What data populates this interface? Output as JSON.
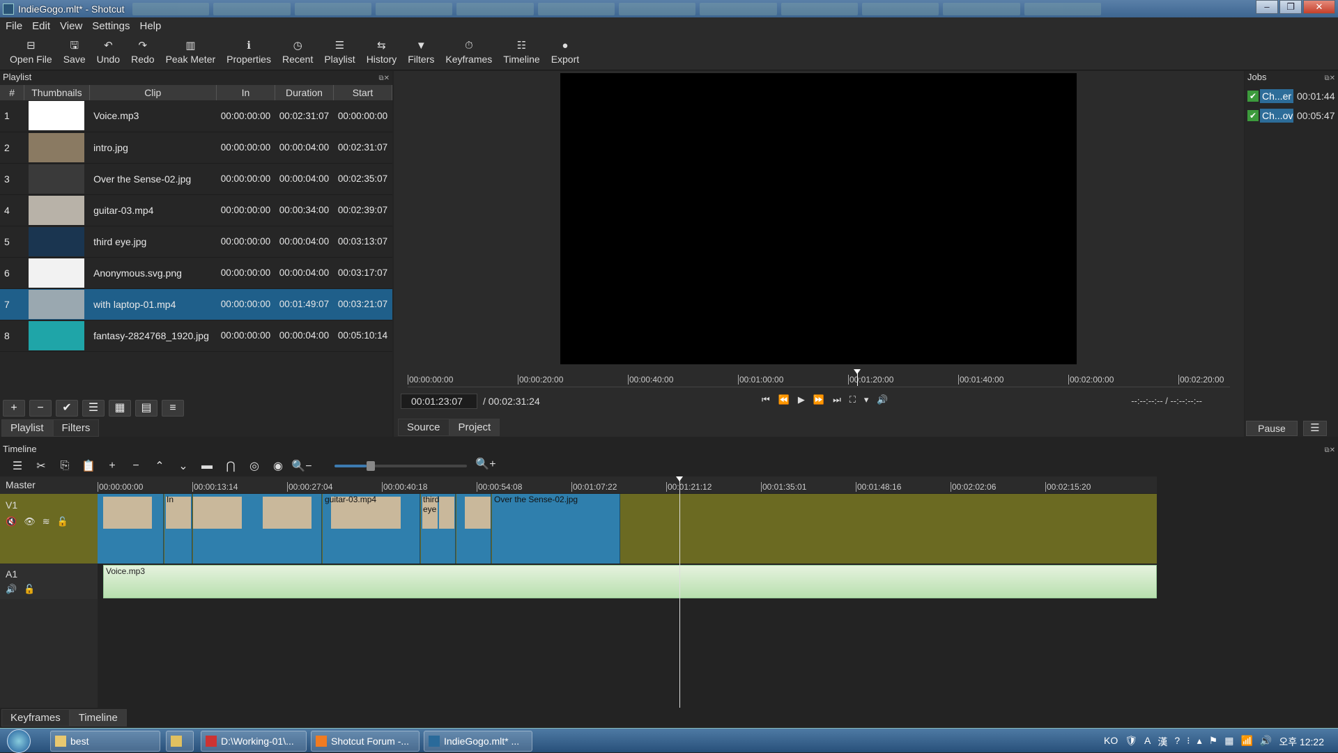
{
  "window": {
    "title": "IndieGogo.mlt* - Shotcut",
    "minimize": "–",
    "maximize": "❐",
    "close": "✕"
  },
  "menu": [
    "File",
    "Edit",
    "View",
    "Settings",
    "Help"
  ],
  "toolbar": [
    {
      "label": "Open File",
      "icon": "⊟"
    },
    {
      "label": "Save",
      "icon": "🖫"
    },
    {
      "label": "Undo",
      "icon": "↶"
    },
    {
      "label": "Redo",
      "icon": "↷"
    },
    {
      "label": "Peak Meter",
      "icon": "▥"
    },
    {
      "label": "Properties",
      "icon": "ℹ"
    },
    {
      "label": "Recent",
      "icon": "◷"
    },
    {
      "label": "Playlist",
      "icon": "☰"
    },
    {
      "label": "History",
      "icon": "⇆"
    },
    {
      "label": "Filters",
      "icon": "▼"
    },
    {
      "label": "Keyframes",
      "icon": "⏱"
    },
    {
      "label": "Timeline",
      "icon": "☷"
    },
    {
      "label": "Export",
      "icon": "●"
    }
  ],
  "playlist": {
    "title": "Playlist",
    "columns": [
      "#",
      "Thumbnails",
      "Clip",
      "In",
      "Duration",
      "Start"
    ],
    "rows": [
      {
        "n": "1",
        "clip": "Voice.mp3",
        "in": "00:00:00:00",
        "duration": "00:02:31:07",
        "start": "00:00:00:00",
        "thumb": "#ffffff"
      },
      {
        "n": "2",
        "clip": "intro.jpg",
        "in": "00:00:00:00",
        "duration": "00:00:04:00",
        "start": "00:02:31:07",
        "thumb": "#8a7a62"
      },
      {
        "n": "3",
        "clip": "Over the Sense-02.jpg",
        "in": "00:00:00:00",
        "duration": "00:00:04:00",
        "start": "00:02:35:07",
        "thumb": "#3a3a3a"
      },
      {
        "n": "4",
        "clip": "guitar-03.mp4",
        "in": "00:00:00:00",
        "duration": "00:00:34:00",
        "start": "00:02:39:07",
        "thumb": "#b8b2a8"
      },
      {
        "n": "5",
        "clip": "third eye.jpg",
        "in": "00:00:00:00",
        "duration": "00:00:04:00",
        "start": "00:03:13:07",
        "thumb": "#1a3550"
      },
      {
        "n": "6",
        "clip": "Anonymous.svg.png",
        "in": "00:00:00:00",
        "duration": "00:00:04:00",
        "start": "00:03:17:07",
        "thumb": "#f2f2f2"
      },
      {
        "n": "7",
        "clip": "with laptop-01.mp4",
        "in": "00:00:00:00",
        "duration": "00:01:49:07",
        "start": "00:03:21:07",
        "thumb": "#9aa8b0",
        "selected": true
      },
      {
        "n": "8",
        "clip": "fantasy-2824768_1920.jpg",
        "in": "00:00:00:00",
        "duration": "00:00:04:00",
        "start": "00:05:10:14",
        "thumb": "#1fa5a8"
      }
    ],
    "buttons": [
      "+",
      "−",
      "✔",
      "☰",
      "▦",
      "▤",
      "≡"
    ],
    "tabs": [
      "Playlist",
      "Filters"
    ]
  },
  "viewer": {
    "ruler": [
      "00:00:00:00",
      "00:00:20:00",
      "00:00:40:00",
      "00:01:00:00",
      "00:01:20:00",
      "00:01:40:00",
      "00:02:00:00",
      "00:02:20:00"
    ],
    "current_time": "00:01:23:07",
    "total_time": "/ 00:02:31:24",
    "transport": [
      "⏮",
      "⏪",
      "▶",
      "⏩",
      "⏭",
      "⛶",
      "▾",
      "🔊"
    ],
    "in_out": "--:--:--:-- / --:--:--:--",
    "tabs": [
      "Source",
      "Project"
    ]
  },
  "jobs": {
    "title": "Jobs",
    "items": [
      {
        "name": "Ch...er",
        "time": "00:01:44"
      },
      {
        "name": "Ch...ov",
        "time": "00:05:47"
      }
    ],
    "pause": "Pause",
    "menu": "☰"
  },
  "timeline": {
    "title": "Timeline",
    "toolbar": [
      "☰",
      "✂",
      "⎘",
      "📋",
      "+",
      "−",
      "⌃",
      "⌄",
      "▬",
      "⋂",
      "◎",
      "◉",
      "🔍−",
      "🔍+"
    ],
    "zoom": 0.24,
    "master": "Master",
    "ruler": [
      "00:00:00:00",
      "00:00:13:14",
      "00:00:27:04",
      "00:00:40:18",
      "00:00:54:08",
      "00:01:07:22",
      "00:01:21:12",
      "00:01:35:01",
      "00:01:48:16",
      "00:02:02:06",
      "00:02:15:20"
    ],
    "tracks": [
      {
        "name": "V1",
        "icons": [
          "🔇",
          "👁",
          "≋",
          "🔓"
        ]
      },
      {
        "name": "A1",
        "icons": [
          "🔊",
          "🔓"
        ]
      }
    ],
    "v1_clips": [
      {
        "label": "",
        "color": "#2f7fad"
      },
      {
        "label": "In",
        "color": "#2f7fad"
      },
      {
        "label": "",
        "color": "#2f7fad"
      },
      {
        "label": "guitar-03.mp4",
        "color": "#2f7fad"
      },
      {
        "label": "third eye",
        "color": "#2f7fad"
      },
      {
        "label": "",
        "color": "#2f7fad"
      },
      {
        "label": "Over the Sense-02.jpg",
        "color": "#2f7fad"
      }
    ],
    "a1_clip": "Voice.mp3"
  },
  "bottom_tabs": [
    "Keyframes",
    "Timeline"
  ],
  "taskbar": {
    "tasks": [
      {
        "label": "best",
        "color": "#e8c870"
      },
      {
        "label": "",
        "color": "#e0c060"
      },
      {
        "label": "D:\\Working-01\\...",
        "color": "#c33"
      },
      {
        "label": "Shotcut Forum -...",
        "color": "#f07b22"
      },
      {
        "label": "IndieGogo.mlt* ...",
        "color": "#2a6a9a"
      }
    ],
    "tray": [
      "KO",
      "🛡",
      "A",
      "漢",
      "?",
      "⁝",
      "▴",
      "⚑",
      "▦",
      "📶",
      "🔊"
    ],
    "clock": "오후 12:22"
  }
}
